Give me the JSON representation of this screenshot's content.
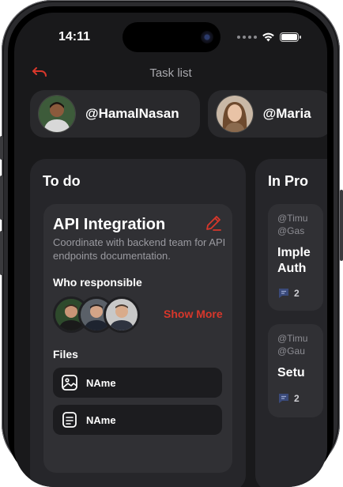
{
  "status_bar": {
    "time": "14:11"
  },
  "header": {
    "title": "Task list",
    "back_icon": "undo-arrow-icon",
    "accent": "#d7372b"
  },
  "users": [
    {
      "handle": "@HamalNasan"
    },
    {
      "handle": "@Maria"
    }
  ],
  "columns": {
    "todo": {
      "title": "To do",
      "card": {
        "title": "API Integration",
        "description": "Coordinate with backend team for API endpoints documentation.",
        "responsible_label": "Who responsible",
        "show_more": "Show More",
        "files_label": "Files",
        "files": [
          {
            "name": "NAme",
            "icon": "image-icon"
          },
          {
            "name": "NAme",
            "icon": "document-icon"
          }
        ]
      }
    },
    "in_progress": {
      "title": "In Pro",
      "cards": [
        {
          "tags": [
            "@Timu",
            "@Gas"
          ],
          "title": [
            "Imple",
            "Auth"
          ],
          "comments": "2"
        },
        {
          "tags": [
            "@Timu",
            "@Gau"
          ],
          "title": [
            "Setu"
          ],
          "comments": "2"
        }
      ]
    }
  },
  "colors": {
    "background": "#19191b",
    "column": "#26262a",
    "card": "#303034",
    "accent": "#d7372b",
    "chat_icon": "#3a4a7a"
  }
}
